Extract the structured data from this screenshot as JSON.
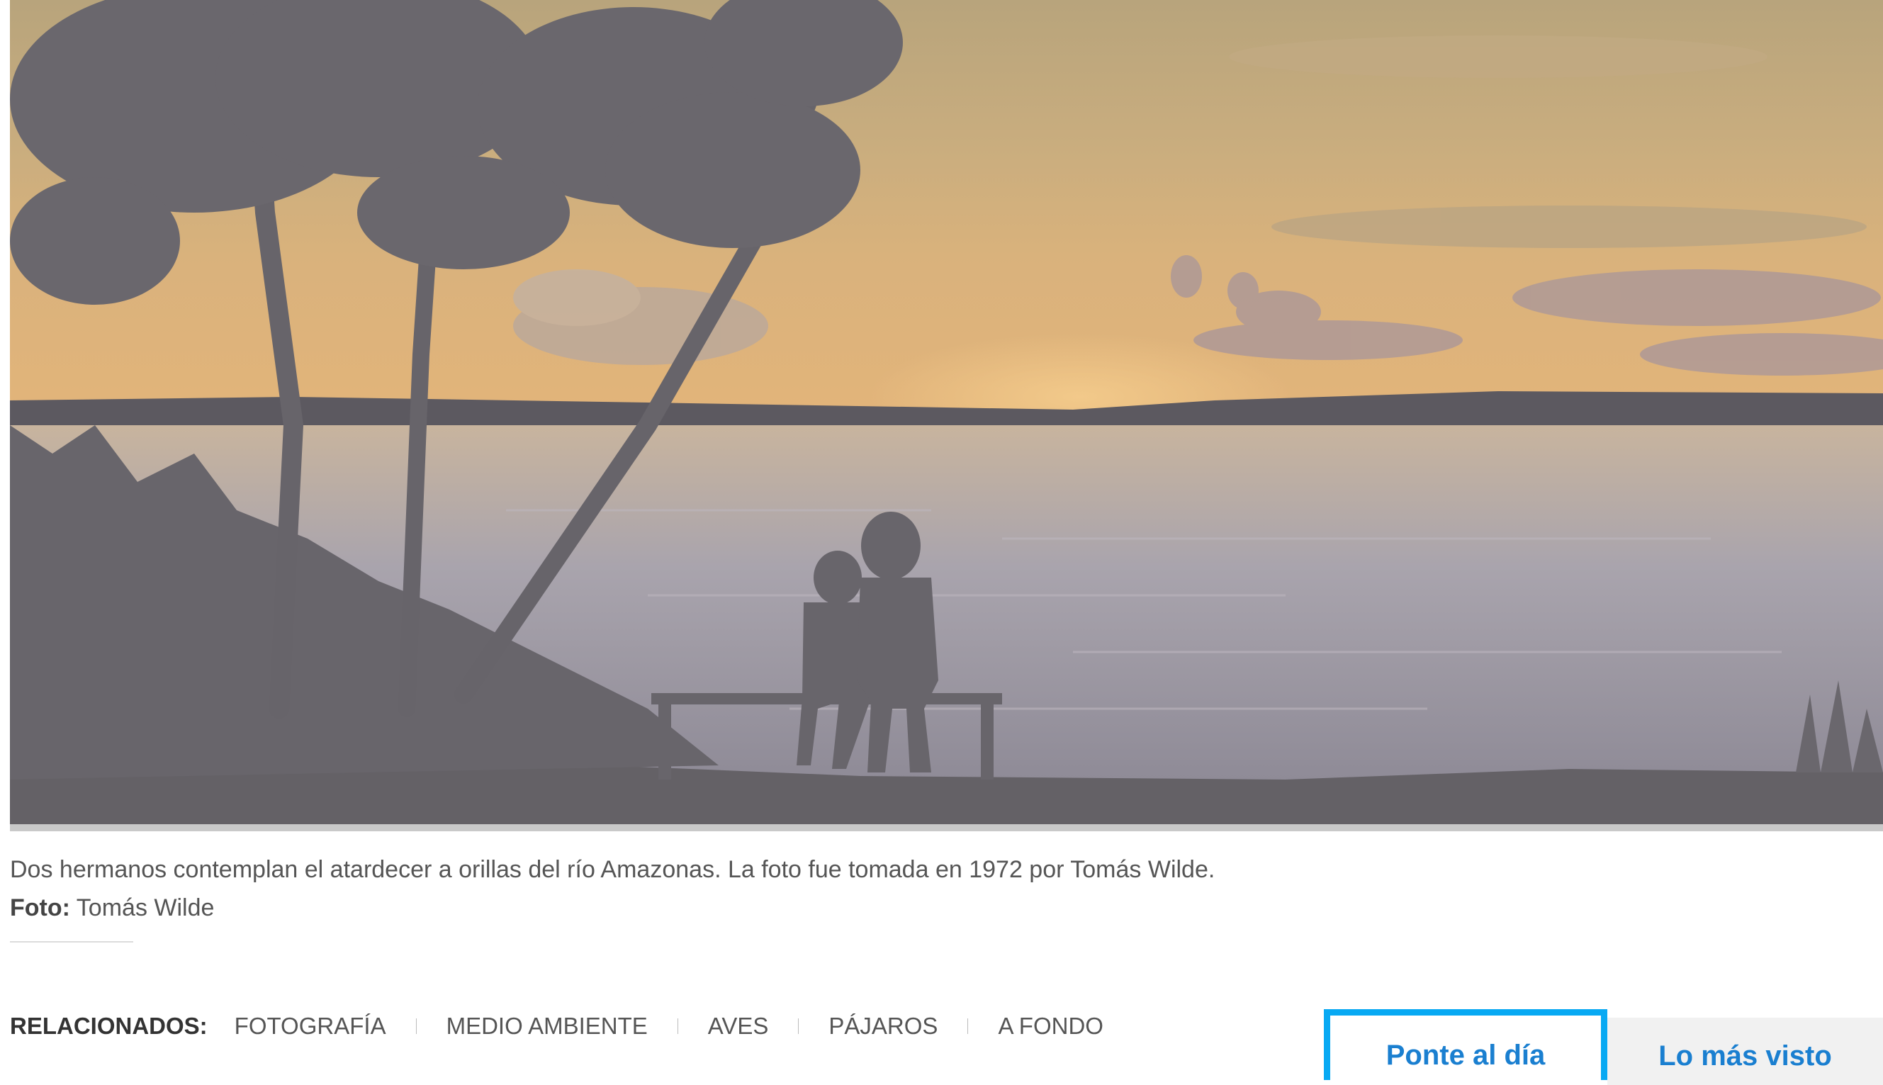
{
  "photo": {
    "caption": "Dos hermanos contemplan el atardecer a orillas del río Amazonas. La foto fue tomada en 1972 por Tomás Wilde.",
    "credit_label": "Foto:",
    "credit_name": "Tomás Wilde"
  },
  "related": {
    "label": "RELACIONADOS:",
    "tags": [
      "FOTOGRAFÍA",
      "MEDIO AMBIENTE",
      "AVES",
      "PÁJAROS",
      "A FONDO"
    ]
  },
  "tabs": [
    {
      "label": "Ponte al día",
      "active": true
    },
    {
      "label": "Lo más visto",
      "active": false
    }
  ],
  "colors": {
    "accent": "#08a9f3",
    "tab_text": "#1a7fd0"
  }
}
